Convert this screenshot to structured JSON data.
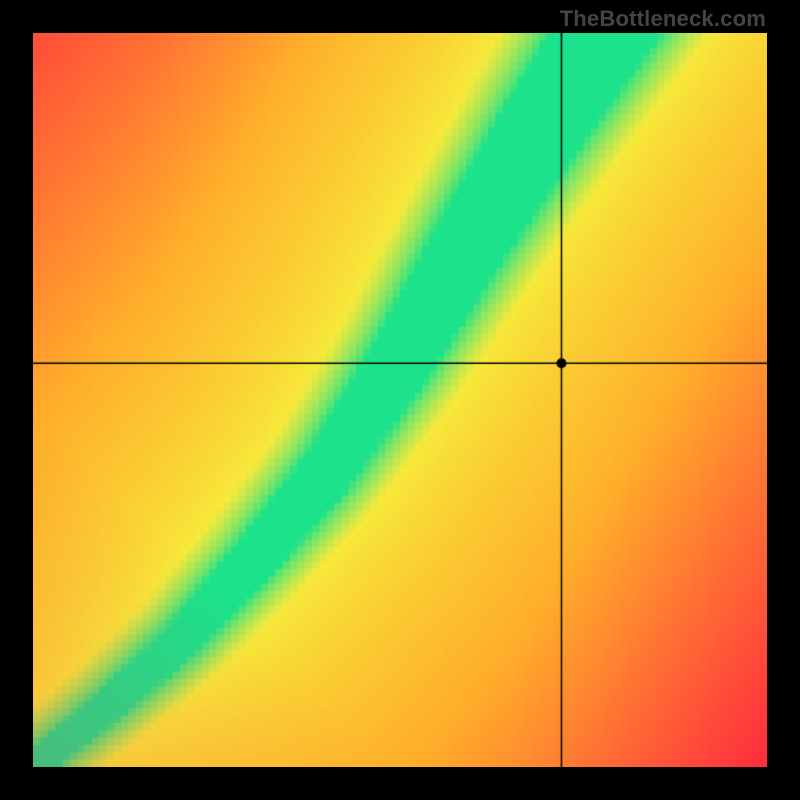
{
  "watermark": "TheBottleneck.com",
  "chart_data": {
    "type": "heatmap",
    "title": "",
    "xlabel": "",
    "ylabel": "",
    "x_range": [
      0,
      1
    ],
    "y_range": [
      0,
      1
    ],
    "crosshair": {
      "x": 0.72,
      "y": 0.55
    },
    "marker": {
      "x": 0.72,
      "y": 0.55
    },
    "ridge_curve": {
      "description": "Green ideal-balance ridge running from bottom-left to top-right, slightly above the diagonal in the upper half",
      "points": [
        {
          "x": 0.0,
          "y": 0.0
        },
        {
          "x": 0.1,
          "y": 0.08
        },
        {
          "x": 0.2,
          "y": 0.17
        },
        {
          "x": 0.3,
          "y": 0.28
        },
        {
          "x": 0.4,
          "y": 0.4
        },
        {
          "x": 0.5,
          "y": 0.55
        },
        {
          "x": 0.6,
          "y": 0.72
        },
        {
          "x": 0.7,
          "y": 0.88
        },
        {
          "x": 0.78,
          "y": 1.0
        }
      ]
    },
    "color_scale": {
      "ridge": "#1ce28b",
      "near_ridge": "#f7ea3b",
      "mid": "#ffae2b",
      "far": "#ff2a3f"
    },
    "pixelation": 100
  }
}
